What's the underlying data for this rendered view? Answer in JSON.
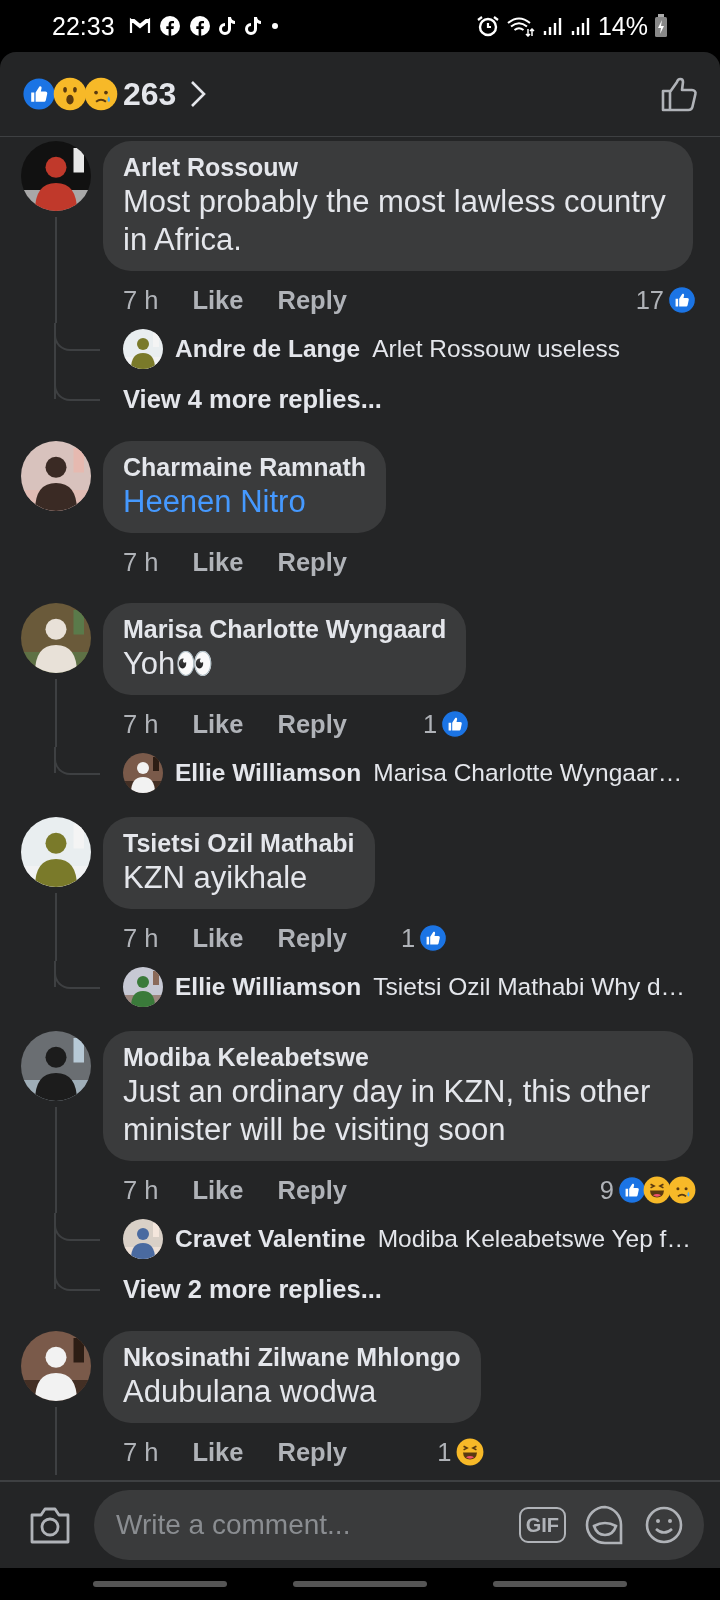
{
  "status_bar": {
    "time": "22:33",
    "notifications": [
      {
        "kind": "gmail"
      },
      {
        "kind": "facebook"
      },
      {
        "kind": "facebook"
      },
      {
        "kind": "tiktok"
      },
      {
        "kind": "tiktok"
      },
      {
        "kind": "dot"
      }
    ],
    "battery_text": "14%"
  },
  "header": {
    "reactions": [
      {
        "kind": "like"
      },
      {
        "kind": "wow"
      },
      {
        "kind": "sad"
      }
    ],
    "count": "263"
  },
  "comments": [
    {
      "author": "Arlet Rossouw",
      "text": "Most probably the most lawless country in Africa.",
      "mention": false,
      "time": "7 h",
      "like": "Like",
      "reply": "Reply",
      "reaction_count": "17",
      "reactions": [
        {
          "kind": "like"
        }
      ],
      "replies": [
        {
          "author": "Andre de Lange",
          "text": "Arlet Rossouw useless"
        }
      ],
      "more_replies": "View 4 more replies...",
      "thread_continues": false
    },
    {
      "author": "Charmaine Ramnath",
      "text": "Heenen Nitro",
      "mention": true,
      "time": "7 h",
      "like": "Like",
      "reply": "Reply",
      "thread_continues": false
    },
    {
      "author": "Marisa Charlotte Wyngaard",
      "text": "Yoh👀",
      "mention": false,
      "time": "7 h",
      "like": "Like",
      "reply": "Reply",
      "reaction_count": "1",
      "reactions": [
        {
          "kind": "like"
        }
      ],
      "replies": [
        {
          "author": "Ellie Williamson",
          "text": "Marisa Charlotte Wyngaar…"
        }
      ],
      "thread_continues": false
    },
    {
      "author": "Tsietsi Ozil Mathabi",
      "text": "KZN ayikhale",
      "mention": false,
      "time": "7 h",
      "like": "Like",
      "reply": "Reply",
      "reaction_count": "1",
      "reactions": [
        {
          "kind": "like"
        }
      ],
      "replies": [
        {
          "author": "Ellie Williamson",
          "text": "Tsietsi Ozil Mathabi Why d…"
        }
      ],
      "thread_continues": false
    },
    {
      "author": "Modiba Keleabetswe",
      "text": "Just an ordinary day in KZN, this other minister will be visiting soon",
      "mention": false,
      "time": "7 h",
      "like": "Like",
      "reply": "Reply",
      "reaction_count": "9",
      "reactions": [
        {
          "kind": "like"
        },
        {
          "kind": "haha"
        },
        {
          "kind": "sad"
        }
      ],
      "replies": [
        {
          "author": "Cravet Valentine",
          "text": "Modiba Keleabetswe Yep f…"
        }
      ],
      "more_replies": "View 2 more replies...",
      "thread_continues": false
    },
    {
      "author": "Nkosinathi Zilwane Mhlongo",
      "text": "Adubulana wodwa",
      "mention": false,
      "time": "7 h",
      "like": "Like",
      "reply": "Reply",
      "reaction_count": "1",
      "reactions": [
        {
          "kind": "haha"
        }
      ],
      "thread_continues": true
    }
  ],
  "composer": {
    "placeholder": "Write a comment...",
    "gif_label": "GIF"
  }
}
